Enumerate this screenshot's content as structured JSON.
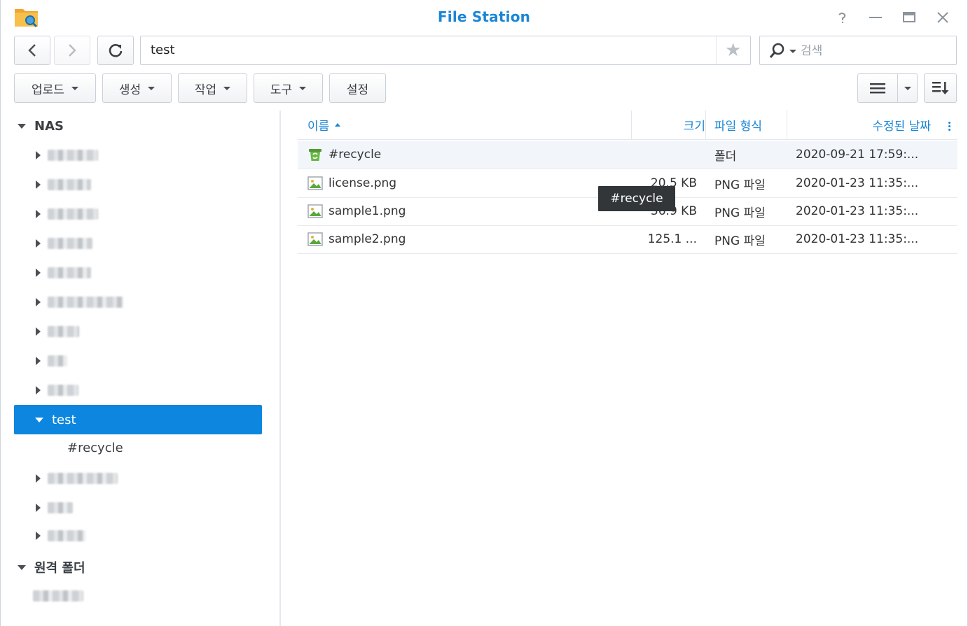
{
  "window": {
    "title": "File Station"
  },
  "nav": {
    "path": "test"
  },
  "search": {
    "placeholder": "검색",
    "value": ""
  },
  "toolbar": {
    "upload": "업로드",
    "create": "생성",
    "action": "작업",
    "tools": "도구",
    "settings": "설정"
  },
  "sidebar": {
    "root_nas": "NAS",
    "selected": "test",
    "selected_child": "#recycle",
    "root_remote": "원격 폴더"
  },
  "columns": {
    "name": "이름",
    "size": "크기",
    "type": "파일 형식",
    "modified": "수정된 날짜"
  },
  "files": [
    {
      "name": "#recycle",
      "size": "",
      "type": "폴더",
      "modified": "2020-09-21 17:59:...",
      "icon": "recycle-folder-icon"
    },
    {
      "name": "license.png",
      "size": "20.5 KB",
      "type": "PNG 파일",
      "modified": "2020-01-23 11:35:...",
      "icon": "image-file-icon"
    },
    {
      "name": "sample1.png",
      "size": "36.9 KB",
      "type": "PNG 파일",
      "modified": "2020-01-23 11:35:...",
      "icon": "image-file-icon"
    },
    {
      "name": "sample2.png",
      "size": "125.1 ...",
      "type": "PNG 파일",
      "modified": "2020-01-23 11:35:...",
      "icon": "image-file-icon"
    }
  ],
  "tooltip": {
    "text": "#recycle"
  },
  "colors": {
    "accent": "#0c86de",
    "title": "#1a86d6",
    "recycle_green": "#5aa83c"
  }
}
